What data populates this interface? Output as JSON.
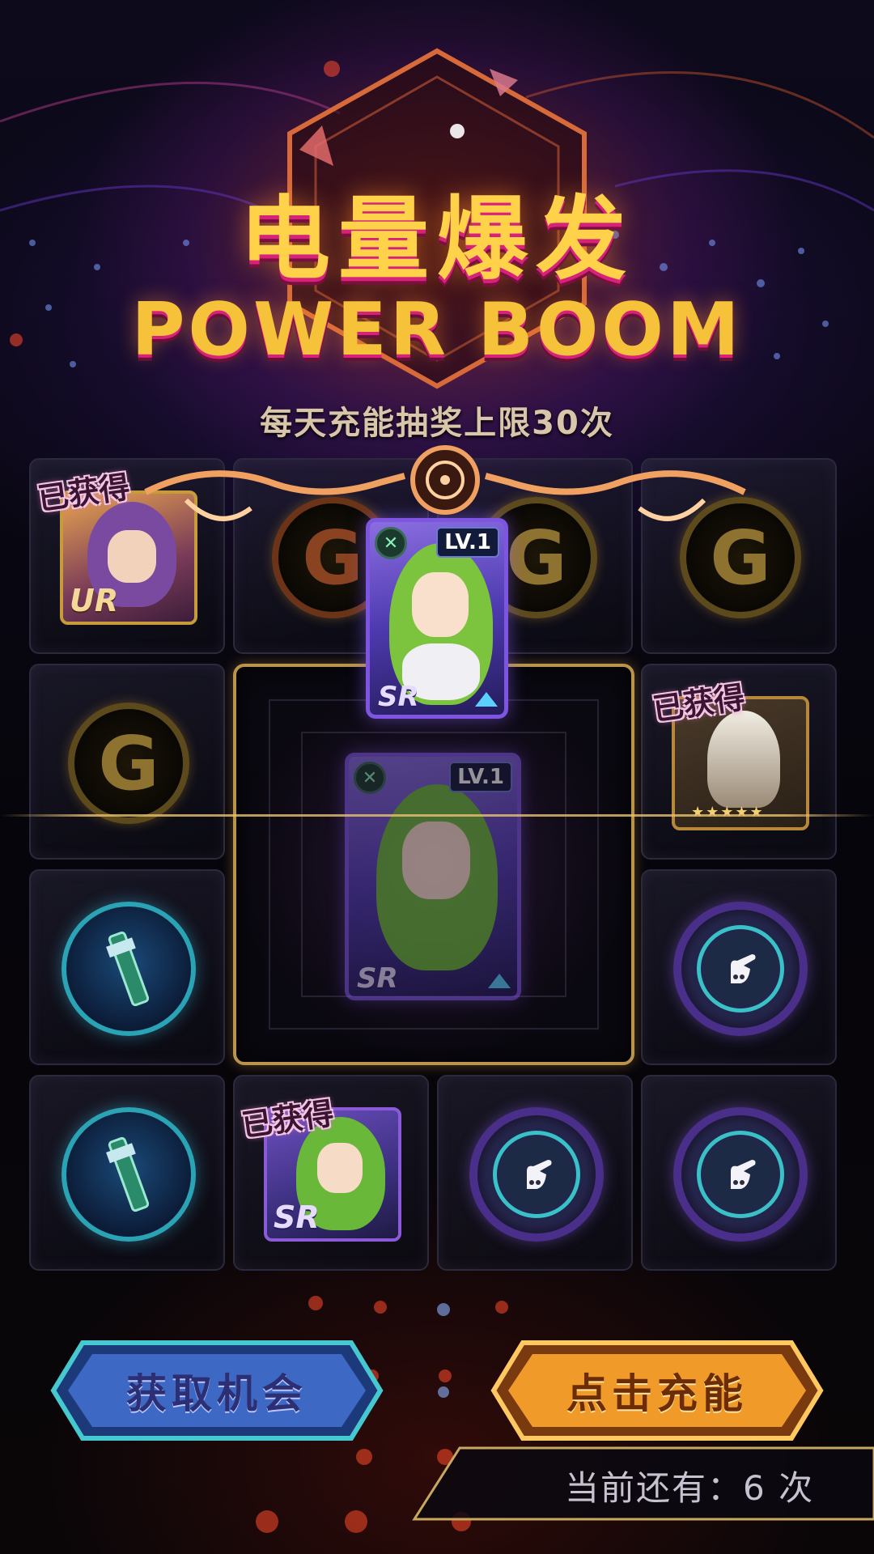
{
  "header": {
    "title_cn": "电量爆发",
    "title_en": "POWER BOOM",
    "subtitle": "每天充能抽奖上限30次"
  },
  "grid": {
    "obtained_label": "已获得",
    "coin_glyph": "G",
    "cells": [
      {
        "row": 0,
        "col": 0,
        "type": "ur-card",
        "rank": "UR",
        "obtained": true
      },
      {
        "row": 0,
        "col": 1,
        "type": "coin-orange"
      },
      {
        "row": 0,
        "col": 2,
        "type": "coin"
      },
      {
        "row": 0,
        "col": 3,
        "type": "coin"
      },
      {
        "row": 1,
        "col": 0,
        "type": "coin"
      },
      {
        "row": 1,
        "col": 3,
        "type": "feather-item",
        "obtained": true
      },
      {
        "row": 2,
        "col": 0,
        "type": "blue-orb"
      },
      {
        "row": 2,
        "col": 3,
        "type": "purple-orb"
      },
      {
        "row": 3,
        "col": 0,
        "type": "blue-orb"
      },
      {
        "row": 3,
        "col": 1,
        "type": "sr-card",
        "rank": "SR",
        "obtained": true
      },
      {
        "row": 3,
        "col": 2,
        "type": "purple-orb"
      },
      {
        "row": 3,
        "col": 3,
        "type": "purple-orb"
      }
    ]
  },
  "reward_card": {
    "rank": "SR",
    "level": "LV.1",
    "element_icon": "x-element-icon"
  },
  "buttons": {
    "get_chance": "获取机会",
    "charge": "点击充能"
  },
  "status": {
    "remaining": "当前还有：6 次"
  },
  "colors": {
    "title_gold": "#ffd24a",
    "title_shadow_pink": "#d8227a",
    "card_purple": "#7e55e0",
    "frame_gold": "#b9944a",
    "button_blue": "#3d69c4",
    "button_orange": "#f09a2a"
  }
}
